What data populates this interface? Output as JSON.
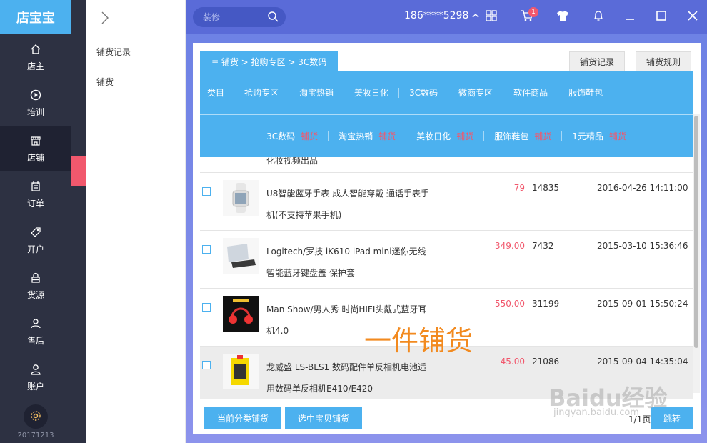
{
  "app": {
    "logo": "店宝宝",
    "version": "20171213"
  },
  "leftnav": [
    {
      "label": "店主",
      "icon": "home-icon"
    },
    {
      "label": "培训",
      "icon": "play-icon"
    },
    {
      "label": "店铺",
      "icon": "store-icon"
    },
    {
      "label": "订单",
      "icon": "order-icon"
    },
    {
      "label": "开户",
      "icon": "tag-icon"
    },
    {
      "label": "货源",
      "icon": "lock-icon"
    },
    {
      "label": "售后",
      "icon": "user-icon"
    },
    {
      "label": "账户",
      "icon": "account-icon"
    }
  ],
  "submenu": {
    "items": [
      "铺货记录",
      "铺货"
    ]
  },
  "topbar": {
    "search_placeholder": "装修",
    "phone": "186****5298",
    "cart_count": "1",
    "accent": "#5a6bd8"
  },
  "panel": {
    "breadcrumb": "≡ 铺货 > 抢购专区 > 3C数码",
    "btn_records": "铺货记录",
    "btn_rules": "铺货规则",
    "categories": [
      "类目",
      "抢购专区",
      "淘宝热销",
      "美妆日化",
      "3C数码",
      "微商专区",
      "软件商品",
      "服饰鞋包"
    ],
    "sub_categories": [
      "3C数码",
      "淘宝热销",
      "美妆日化",
      "服饰鞋包",
      "1元精品"
    ],
    "sub_tag": "铺货",
    "partial_row_text": "化妆视频出品"
  },
  "products": [
    {
      "title": "U8智能蓝牙手表 成人智能穿戴 通话手表手机(不支持苹果手机)",
      "price": "79",
      "sales": "14835",
      "date": "2016-04-26 14:11:00"
    },
    {
      "title": "Logitech/罗技 iK610 iPad mini迷你无线智能蓝牙键盘盖 保护套",
      "price": "349.00",
      "sales": "7432",
      "date": "2015-03-10 15:36:46"
    },
    {
      "title": "Man Show/男人秀 时尚HIFI头戴式蓝牙耳机4.0",
      "price": "550.00",
      "sales": "31199",
      "date": "2015-09-01 15:50:24"
    },
    {
      "title": "龙威盛 LS-BLS1 数码配件单反相机电池适用数码单反相机E410/E420",
      "price": "45.00",
      "sales": "21086",
      "date": "2015-09-04 14:35:04"
    }
  ],
  "footer": {
    "btn_category": "当前分类铺货",
    "btn_selected": "选中宝贝铺货",
    "page_info": "1/1页",
    "jump": "跳转"
  },
  "overlay": {
    "watermark": "一件铺货",
    "baidu": "Baidu经验",
    "baidu_url": "jingyan.baidu.com"
  }
}
